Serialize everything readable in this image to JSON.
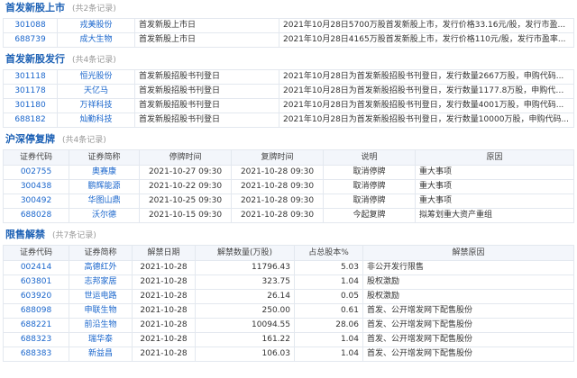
{
  "listing": {
    "title": "首发新股上市",
    "count": "(共2条记录)",
    "rows": [
      {
        "code": "301088",
        "name": "戎美股份",
        "type": "首发新股上市日",
        "desc": "2021年10月28日5700万股首发新股上市，发行价格33.16元/股，发行市盈..."
      },
      {
        "code": "688739",
        "name": "成大生物",
        "type": "首发新股上市日",
        "desc": "2021年10月28日4165万股首发新股上市，发行价格110元/股，发行市盈率..."
      }
    ]
  },
  "issuance": {
    "title": "首发新股发行",
    "count": "(共4条记录)",
    "rows": [
      {
        "code": "301118",
        "name": "恒光股份",
        "type": "首发新股招股书刊登日",
        "desc": "2021年10月28日为首发新股招股书刊登日，发行数量2667万股，申购代码..."
      },
      {
        "code": "301178",
        "name": "天亿马",
        "type": "首发新股招股书刊登日",
        "desc": "2021年10月28日为首发新股招股书刊登日，发行数量1177.8万股，申购代码..."
      },
      {
        "code": "301180",
        "name": "万祥科技",
        "type": "首发新股招股书刊登日",
        "desc": "2021年10月28日为首发新股招股书刊登日，发行数量4001万股，申购代码..."
      },
      {
        "code": "688182",
        "name": "灿勤科技",
        "type": "首发新股招股书刊登日",
        "desc": "2021年10月28日为首发新股招股书刊登日，发行数量10000万股，申购代码..."
      }
    ]
  },
  "suspension": {
    "title": "沪深停复牌",
    "count": "(共4条记录)",
    "headers": [
      "证券代码",
      "证券简称",
      "停牌时间",
      "复牌时间",
      "说明",
      "原因"
    ],
    "rows": [
      {
        "code": "002755",
        "name": "奥赛康",
        "halt": "2021-10-27 09:30",
        "resume": "2021-10-28 09:30",
        "note": "取消停牌",
        "reason": "重大事项"
      },
      {
        "code": "300438",
        "name": "鹏辉能源",
        "halt": "2021-10-22 09:30",
        "resume": "2021-10-28 09:30",
        "note": "取消停牌",
        "reason": "重大事项"
      },
      {
        "code": "300492",
        "name": "华图山鼎",
        "halt": "2021-10-25 09:30",
        "resume": "2021-10-28 09:30",
        "note": "取消停牌",
        "reason": "重大事项"
      },
      {
        "code": "688028",
        "name": "沃尔德",
        "halt": "2021-10-15 09:30",
        "resume": "2021-10-28 09:30",
        "note": "今起复牌",
        "reason": "拟筹划重大资产重组"
      }
    ]
  },
  "unlock": {
    "title": "限售解禁",
    "count": "(共7条记录)",
    "headers": [
      "证券代码",
      "证券简称",
      "解禁日期",
      "解禁数量(万股)",
      "占总股本%",
      "解禁原因"
    ],
    "rows": [
      {
        "code": "002414",
        "name": "高德红外",
        "date": "2021-10-28",
        "qty": "11796.43",
        "pct": "5.03",
        "reason": "非公开发行限售"
      },
      {
        "code": "603801",
        "name": "志邦家居",
        "date": "2021-10-28",
        "qty": "323.75",
        "pct": "1.04",
        "reason": "股权激励"
      },
      {
        "code": "603920",
        "name": "世运电路",
        "date": "2021-10-28",
        "qty": "26.14",
        "pct": "0.05",
        "reason": "股权激励"
      },
      {
        "code": "688098",
        "name": "申联生物",
        "date": "2021-10-28",
        "qty": "250.00",
        "pct": "0.61",
        "reason": "首发、公开增发网下配售股份"
      },
      {
        "code": "688221",
        "name": "前沿生物",
        "date": "2021-10-28",
        "qty": "10094.55",
        "pct": "28.06",
        "reason": "首发、公开增发网下配售股份"
      },
      {
        "code": "688323",
        "name": "瑞华泰",
        "date": "2021-10-28",
        "qty": "161.22",
        "pct": "1.04",
        "reason": "首发、公开增发网下配售股份"
      },
      {
        "code": "688383",
        "name": "新益昌",
        "date": "2021-10-28",
        "qty": "106.03",
        "pct": "1.04",
        "reason": "首发、公开增发网下配售股份"
      }
    ]
  }
}
